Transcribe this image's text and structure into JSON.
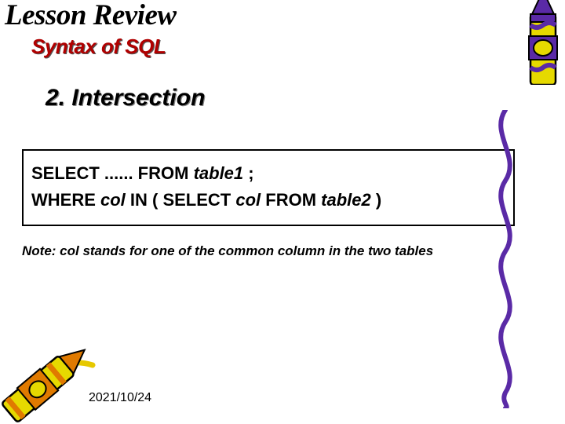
{
  "title": "Lesson Review",
  "subtitle": "Syntax of SQL",
  "section": "2. Intersection",
  "code": {
    "line1_a": "SELECT ...... FROM ",
    "line1_b": "table1",
    "line1_c": " ;",
    "line2_a": "WHERE ",
    "line2_b": "col",
    "line2_c": " IN  ( SELECT ",
    "line2_d": "col",
    "line2_e": " FROM ",
    "line2_f": "table2",
    "line2_g": " )"
  },
  "note": "Note: col stands for one of the common column in the two tables",
  "date": "2021/10/24",
  "colors": {
    "subtitle": "#b00000",
    "crayon_purple_body": "#e6d900",
    "crayon_purple_accent": "#5a2aa6",
    "crayon_yellow_body": "#e6d900",
    "crayon_yellow_accent": "#e07a00",
    "squiggle": "#5a2aa6",
    "yellow_stroke": "#e6c800"
  }
}
